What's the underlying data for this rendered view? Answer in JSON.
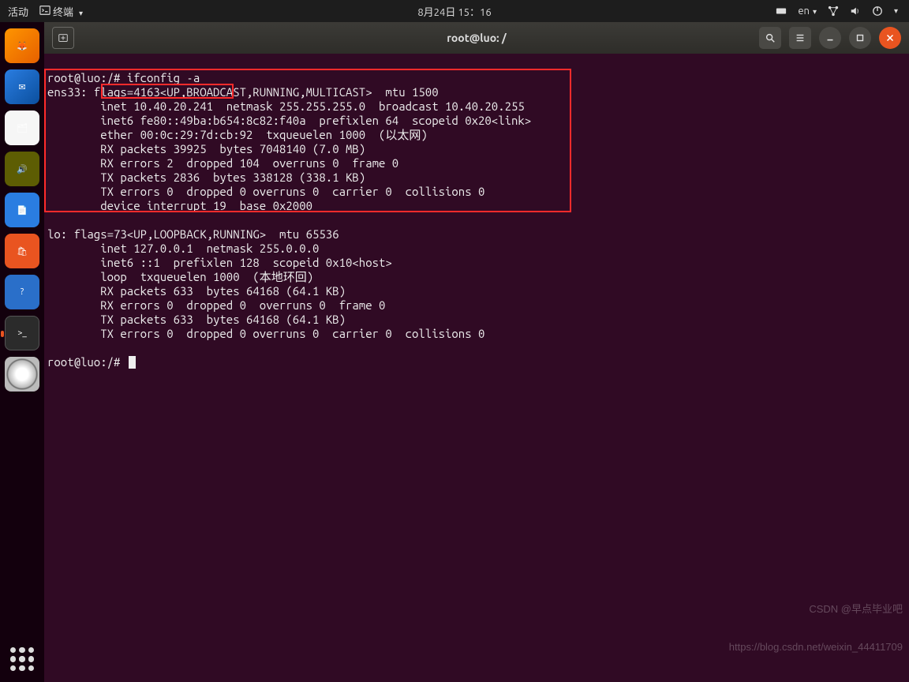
{
  "topbar": {
    "activities": "活动",
    "app_indicator": "终端",
    "clock": "8月24日 15：16",
    "lang": "en"
  },
  "dock": {
    "apps": [
      {
        "name": "firefox",
        "label": "Firefox"
      },
      {
        "name": "thunderbird",
        "label": "TB"
      },
      {
        "name": "files",
        "label": "📁"
      },
      {
        "name": "rhythmbox",
        "label": "♪"
      },
      {
        "name": "libreoffice",
        "label": "W"
      },
      {
        "name": "software",
        "label": "A"
      },
      {
        "name": "help",
        "label": "?"
      },
      {
        "name": "terminal-app",
        "label": ">_",
        "active": true
      },
      {
        "name": "disc",
        "label": ""
      }
    ]
  },
  "window": {
    "title": "root@luo: /",
    "prompt1": "root@luo:/# ",
    "cmd1": "ifconfig -a",
    "ens33": {
      "l1": "ens33: flags=4163<UP,BROADCAST,RUNNING,MULTICAST>  mtu 1500",
      "l2": "        inet 10.40.20.241  netmask 255.255.255.0  broadcast 10.40.20.255",
      "l3": "        inet6 fe80::49ba:b654:8c82:f40a  prefixlen 64  scopeid 0x20<link>",
      "l4": "        ether 00:0c:29:7d:cb:92  txqueuelen 1000  (以太网)",
      "l5": "        RX packets 39925  bytes 7048140 (7.0 MB)",
      "l6": "        RX errors 2  dropped 104  overruns 0  frame 0",
      "l7": "        TX packets 2836  bytes 338128 (338.1 KB)",
      "l8": "        TX errors 0  dropped 0 overruns 0  carrier 0  collisions 0",
      "l9": "        device interrupt 19  base 0x2000"
    },
    "lo": {
      "l1": "lo: flags=73<UP,LOOPBACK,RUNNING>  mtu 65536",
      "l2": "        inet 127.0.0.1  netmask 255.0.0.0",
      "l3": "        inet6 ::1  prefixlen 128  scopeid 0x10<host>",
      "l4": "        loop  txqueuelen 1000  (本地环回)",
      "l5": "        RX packets 633  bytes 64168 (64.1 KB)",
      "l6": "        RX errors 0  dropped 0  overruns 0  frame 0",
      "l7": "        TX packets 633  bytes 64168 (64.1 KB)",
      "l8": "        TX errors 0  dropped 0 overruns 0  carrier 0  collisions 0"
    },
    "prompt2": "root@luo:/# "
  },
  "watermark": {
    "l1": "CSDN @早点毕业吧",
    "l2": "https://blog.csdn.net/weixin_44411709"
  }
}
